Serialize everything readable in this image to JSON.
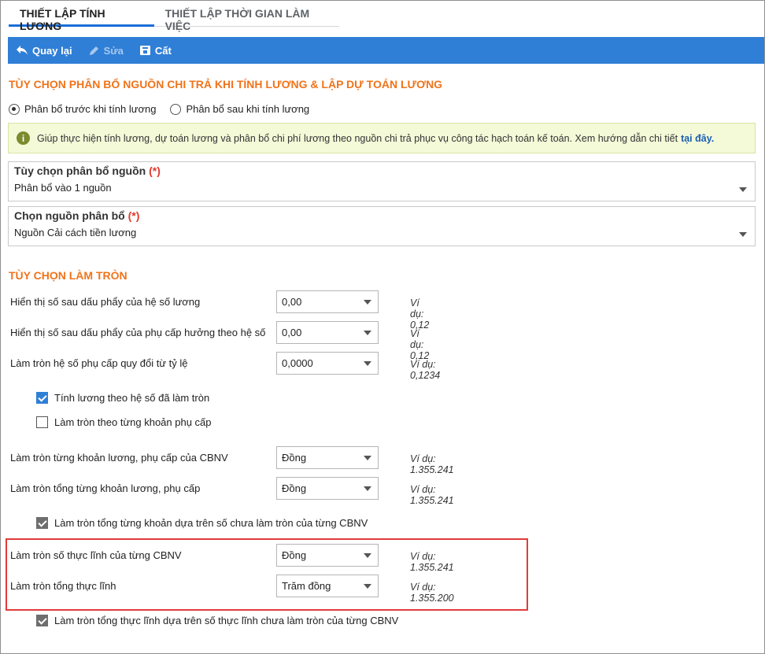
{
  "tabs": [
    {
      "label": "THIẾT LẬP TÍNH LƯƠNG",
      "active": true
    },
    {
      "label": "THIẾT LẬP THỜI GIAN LÀM VIỆC",
      "active": false
    }
  ],
  "toolbar": {
    "back": "Quay lại",
    "edit": "Sửa",
    "save": "Cất"
  },
  "allocation": {
    "title": "TÙY CHỌN PHÂN BỔ NGUỒN CHI TRẢ KHI TÍNH LƯƠNG & LẬP DỰ TOÁN LƯƠNG",
    "radio_before": "Phân bổ trước khi tính lương",
    "radio_after": "Phân bổ sau khi tính lương",
    "info_text": "Giúp thực hiện tính lương, dự toán lương và phân bổ chi phí lương theo nguồn chi trả phục vụ công tác hạch toán kế toán. Xem hướng dẫn chi tiết",
    "info_link": "tại đây.",
    "source_option_label": "Tùy chọn phân bổ nguồn",
    "source_option_value": "Phân bổ vào 1 nguồn",
    "source_label": "Chọn nguồn phân bổ",
    "source_value": "Nguồn Cải cách tiền lương",
    "required_mark": "(*)"
  },
  "rounding": {
    "title": "TÙY CHỌN LÀM TRÒN",
    "rows": [
      {
        "label": "Hiển thị số sau dấu phẩy của hệ số lương",
        "value": "0,00",
        "example": "Ví dụ: 0,12"
      },
      {
        "label": "Hiển thị số sau dấu phẩy của phụ cấp hưởng theo hệ số",
        "value": "0,00",
        "example": "Ví dụ: 0,12"
      },
      {
        "label": "Làm tròn hệ số phụ cấp quy đổi từ tỷ lệ",
        "value": "0,0000",
        "example": "Ví dụ: 0,1234"
      },
      {
        "label": "Làm tròn từng khoản lương, phụ cấp của CBNV",
        "value": "Đồng",
        "example": "Ví dụ: 1.355.241"
      },
      {
        "label": "Làm tròn tổng từng khoản lương, phụ cấp",
        "value": "Đồng",
        "example": "Ví dụ: 1.355.241"
      },
      {
        "label": "Làm tròn số thực lĩnh của từng CBNV",
        "value": "Đồng",
        "example": "Ví dụ: 1.355.241"
      },
      {
        "label": "Làm tròn tổng thực lĩnh",
        "value": "Trăm đồng",
        "example": "Ví dụ: 1.355.200"
      }
    ],
    "checks": [
      {
        "label": "Tính lương theo hệ số đã làm tròn",
        "checked": true
      },
      {
        "label": "Làm tròn theo từng khoản phụ cấp",
        "checked": false
      },
      {
        "label": "Làm tròn tổng từng khoản dựa trên số chưa làm tròn của từng CBNV",
        "checked": true
      },
      {
        "label": "Làm tròn tổng thực lĩnh dựa trên số thực lĩnh chưa làm tròn của từng CBNV",
        "checked": true
      }
    ]
  },
  "colors": {
    "accent": "#2f7fd6",
    "section_title": "#f0731a",
    "highlight": "#e23b3b"
  }
}
